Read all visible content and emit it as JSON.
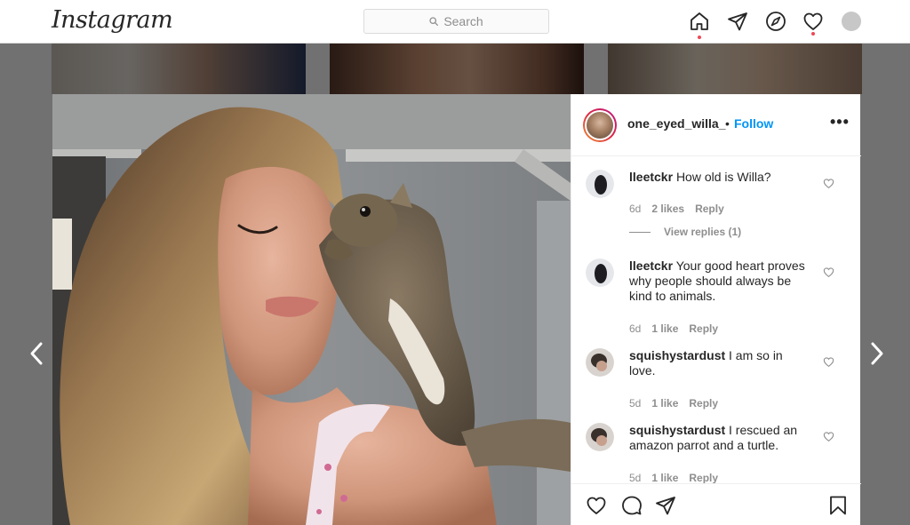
{
  "header": {
    "logo": "Instagram",
    "search": {
      "placeholder": "Search"
    },
    "nav": [
      {
        "name": "home-icon",
        "notification_dot": true
      },
      {
        "name": "direct-icon",
        "notification_dot": false
      },
      {
        "name": "explore-icon",
        "notification_dot": false
      },
      {
        "name": "activity-icon",
        "notification_dot": true
      },
      {
        "name": "profile-avatar",
        "notification_dot": false
      }
    ]
  },
  "post": {
    "author": "one_eyed_willa_",
    "separator": "•",
    "follow_label": "Follow",
    "more_label": "•••",
    "comments": [
      {
        "user": "lleetckr",
        "text": "How old is Willa?",
        "time": "6d",
        "likes": "2 likes",
        "reply_label": "Reply"
      },
      {
        "user": "lleetckr",
        "text": "Your good heart proves why people should always be kind to animals.",
        "time": "6d",
        "likes": "1 like",
        "reply_label": "Reply"
      },
      {
        "user": "squishystardust",
        "text": "I am so in love.",
        "time": "5d",
        "likes": "1 like",
        "reply_label": "Reply"
      },
      {
        "user": "squishystardust",
        "text": "I rescued an amazon parrot and a turtle.",
        "time": "5d",
        "likes": "1 like",
        "reply_label": "Reply"
      }
    ],
    "view_replies_label": "View replies (1)",
    "actions": [
      "like-icon",
      "comment-icon",
      "share-icon",
      "save-icon"
    ]
  },
  "colors": {
    "accent": "#0095f6",
    "text": "#262626",
    "muted": "#8e8e8e",
    "notification": "#ed4956",
    "divider": "#efefef"
  }
}
